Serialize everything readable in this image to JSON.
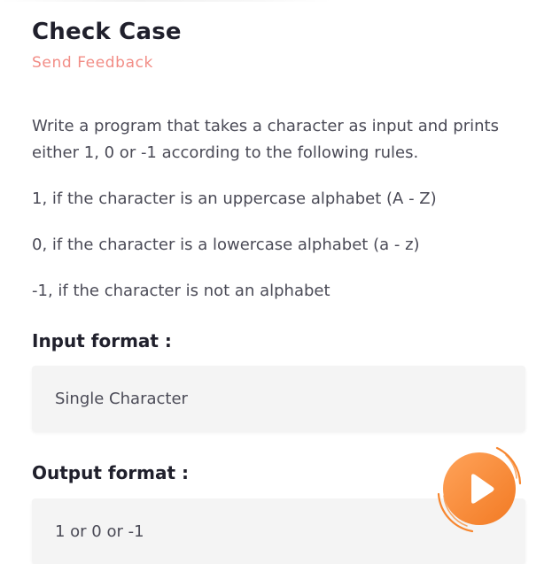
{
  "problem": {
    "title": "Check Case",
    "feedback_label": "Send Feedback",
    "description": [
      "Write a program that takes a character as input and prints either 1, 0 or -1 according to the following rules.",
      "1, if the character is an uppercase alphabet (A - Z)",
      "0, if the character is a lowercase alphabet (a - z)",
      "-1, if the character is not an alphabet"
    ],
    "input_format": {
      "heading": "Input format :",
      "value": "Single Character"
    },
    "output_format": {
      "heading": "Output format :",
      "value": "1 or 0 or -1"
    }
  },
  "colors": {
    "accent": "#f28d86",
    "fab_orange": "#f7862e",
    "fab_orange_light": "#ffa35a",
    "box_bg": "#f4f4f4"
  },
  "icons": {
    "fab": "play-icon"
  }
}
